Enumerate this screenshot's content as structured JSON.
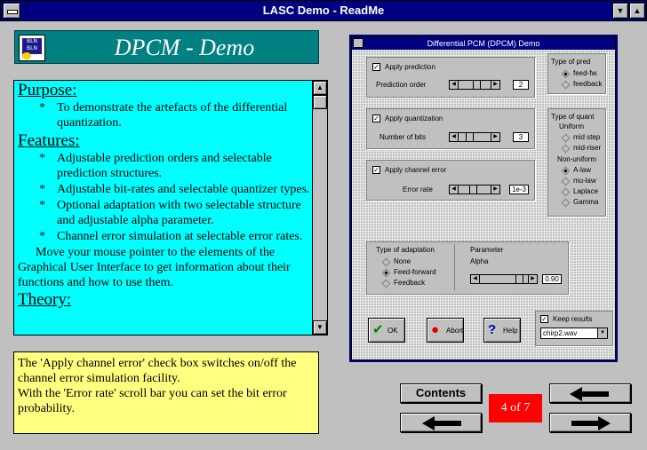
{
  "window": {
    "title": "LASC Demo - ReadMe"
  },
  "banner": {
    "title": "DPCM - Demo",
    "logo_text": "BLN BLN"
  },
  "readme": {
    "purpose_heading": "Purpose:",
    "purpose_items": [
      "To demonstrate the artefacts of the differential quantization."
    ],
    "features_heading": "Features:",
    "feature_items": [
      "Adjustable prediction orders and selectable prediction structures.",
      "Adjustable bit-rates and selectable quantizer types.",
      "Optional adaptation with two selectable structure and adjustable alpha parameter.",
      "Channel error simulation at selectable error rates."
    ],
    "paragraph": "Move your mouse pointer to the elements of the Graphical User Interface to get information about their functions and how to use them.",
    "theory_heading": "Theory:",
    "bullet": "*"
  },
  "help_text": {
    "line1": "The 'Apply channel error' check box switches on/off the channel error simulation facility.",
    "line2": "With the 'Error rate' scroll bar you can set the bit error probability."
  },
  "screenshot": {
    "title": "Differential PCM (DPCM)  Demo",
    "prediction": {
      "checkbox": "Apply prediction",
      "label": "Prediction order",
      "value": "2",
      "position": 0.6
    },
    "quantization": {
      "checkbox": "Apply quantization",
      "label": "Number of bits",
      "value": "3",
      "position": 0.28
    },
    "channel": {
      "checkbox": "Apply channel error",
      "label": "Error rate",
      "value": "1e-3",
      "position": 0.45
    },
    "type_of_pred": {
      "title": "Type of pred",
      "options": [
        "feed-fw.",
        "feedback"
      ],
      "selected": 0
    },
    "type_of_quant": {
      "title": "Type of quant",
      "uniform_label": "Uniform",
      "uniform_options": [
        "mid step",
        "mid-riser"
      ],
      "nonuniform_label": "Non-uniform",
      "nonuniform_options": [
        "A-law",
        "mu-law",
        "Laplace",
        "Gamma"
      ],
      "selected": "A-law"
    },
    "adaptation": {
      "title": "Type of adaptation",
      "options": [
        "None",
        "Feed-forward",
        "Feedback"
      ],
      "selected": 1
    },
    "parameter": {
      "title": "Parameter",
      "label": "Alpha",
      "value": "0.90",
      "position": 0.88
    },
    "buttons": {
      "ok": "OK",
      "abort": "Abort",
      "help": "Help"
    },
    "keep_results": {
      "label": "Keep results",
      "file": "chirp2.wav"
    }
  },
  "nav": {
    "contents": "Contents",
    "page": "4 of 7"
  },
  "colors": {
    "titlebar": "#000080",
    "banner": "#008080",
    "text_panel": "#00ffff",
    "help_panel": "#ffff80",
    "page_box": "#ff0000"
  }
}
